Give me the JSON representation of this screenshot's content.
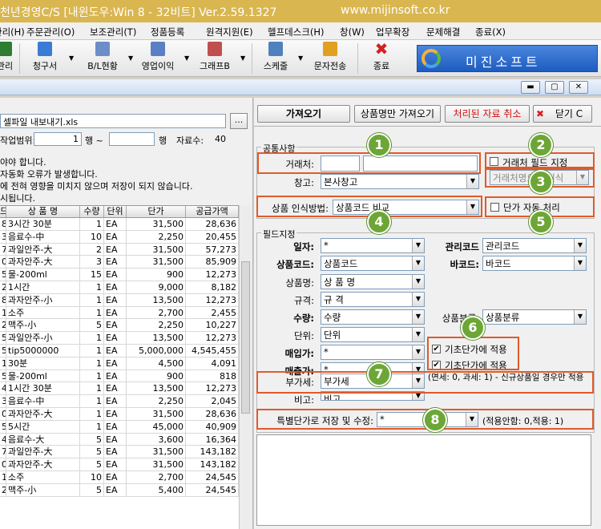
{
  "window": {
    "title": "천년경영C/S [내윈도우:Win 8 - 32비트] Ver.2.59.1327",
    "url": "www.mijinsoft.co.kr"
  },
  "menu": [
    "관리(H)",
    "주문관리(O)",
    "보조관리(T)",
    "정품등록",
    "원격지원(E)",
    "헬프데스크(H)",
    "창(W)",
    "업무확장",
    "문제해결",
    "종료(X)"
  ],
  "toolbar": {
    "items": [
      {
        "label": "관리",
        "icon": "manage-icon",
        "color": "#2e7d32"
      },
      {
        "label": "청구서",
        "icon": "invoice-icon",
        "color": "#3a7bd5"
      },
      {
        "label": "B/L현황",
        "icon": "bl-status-icon",
        "color": "#6b8ec9"
      },
      {
        "label": "영업이익",
        "icon": "sales-profit-icon",
        "color": "#5a7fc4"
      },
      {
        "label": "그래프B",
        "icon": "graph-icon",
        "color": "#c0504d"
      },
      {
        "label": "스케줄",
        "icon": "schedule-icon",
        "color": "#4f81bd"
      },
      {
        "label": "문자전송",
        "icon": "sms-icon",
        "color": "#e0a020"
      },
      {
        "label": "종료",
        "icon": "exit-icon",
        "color": "#d62020"
      }
    ],
    "logo_text": "미진소프트"
  },
  "left": {
    "file_name": "셀파일 내보내기.xls",
    "browse_label": "...",
    "range_label": "작업범위:",
    "range_from": "1",
    "row_label": "행 ~",
    "range_to": "",
    "row_label2": "행",
    "count_label": "자료수:",
    "count_value": "40",
    "notices": [
      "야야 합니다.",
      "자동화 오류가 발생합니다.",
      "에 전혀 영향을 미치지 않으며 저장이 되지 않습니다.",
      "시됩니다."
    ],
    "grid": {
      "headers": [
        "드",
        "상 품 명",
        "수량",
        "단위",
        "단가",
        "공급가액"
      ],
      "rows": [
        [
          "8",
          "3시간 30분",
          "1",
          "EA",
          "31,500",
          "28,636"
        ],
        [
          "3",
          "음료수-中",
          "10",
          "EA",
          "2,250",
          "20,455"
        ],
        [
          "7",
          "과일안주-大",
          "2",
          "EA",
          "31,500",
          "57,273"
        ],
        [
          "0",
          "과자안주-大",
          "3",
          "EA",
          "31,500",
          "85,909"
        ],
        [
          "5",
          "물-200ml",
          "15",
          "EA",
          "900",
          "12,273"
        ],
        [
          "2",
          "1시간",
          "1",
          "EA",
          "9,000",
          "8,182"
        ],
        [
          "8",
          "과자안주-小",
          "1",
          "EA",
          "13,500",
          "12,273"
        ],
        [
          "1",
          "소주",
          "1",
          "EA",
          "2,700",
          "2,455"
        ],
        [
          "2",
          "맥주-小",
          "5",
          "EA",
          "2,250",
          "10,227"
        ],
        [
          "5",
          "과일안주-小",
          "1",
          "EA",
          "13,500",
          "12,273"
        ],
        [
          "5",
          "tip5000000",
          "1",
          "EA",
          "5,000,000",
          "4,545,455"
        ],
        [
          "1",
          "30분",
          "1",
          "EA",
          "4,500",
          "4,091"
        ],
        [
          "5",
          "물-200ml",
          "1",
          "EA",
          "900",
          "818"
        ],
        [
          "4",
          "1시간 30분",
          "1",
          "EA",
          "13,500",
          "12,273"
        ],
        [
          "3",
          "음료수-中",
          "1",
          "EA",
          "2,250",
          "2,045"
        ],
        [
          "0",
          "과자안주-大",
          "1",
          "EA",
          "31,500",
          "28,636"
        ],
        [
          "5",
          "5시간",
          "1",
          "EA",
          "45,000",
          "40,909"
        ],
        [
          "4",
          "음료수-大",
          "5",
          "EA",
          "3,600",
          "16,364"
        ],
        [
          "7",
          "과일안주-大",
          "5",
          "EA",
          "31,500",
          "143,182"
        ],
        [
          "0",
          "과자안주-大",
          "5",
          "EA",
          "31,500",
          "143,182"
        ],
        [
          "1",
          "소주",
          "10",
          "EA",
          "2,700",
          "24,545"
        ],
        [
          "2",
          "맥주-小",
          "5",
          "EA",
          "5,400",
          "24,545"
        ]
      ]
    }
  },
  "right": {
    "buttons": {
      "fetch": "가져오기",
      "fetch_name": "상품명만 가져오기",
      "cancel": "처리된 자료 취소",
      "close": "닫기 C"
    },
    "common": {
      "title": "공통사항",
      "vendor_label": "거래처:",
      "vendor_code": "",
      "vendor_name": "",
      "warehouse_label": "창고:",
      "warehouse_value": "본사창고",
      "vendor_field_check": "거래처 필드 지정",
      "vendor_name_select": "거래처명으로 인식",
      "product_method_label": "상품 인식방법:",
      "product_method_value": "상품코드 비교",
      "auto_price_check": "단가 자동 처리"
    },
    "fields": {
      "title": "필드지정",
      "date": {
        "label": "일자:",
        "value": "*"
      },
      "mgmt_code": {
        "label": "관리코드",
        "value": "관리코드"
      },
      "product_code": {
        "label": "상품코드:",
        "value": "상품코드"
      },
      "barcode": {
        "label": "바코드:",
        "value": "바코드"
      },
      "product_name": {
        "label": "상품명:",
        "value": "상 품 명"
      },
      "spec": {
        "label": "규격:",
        "value": "규 격"
      },
      "qty": {
        "label": "수량:",
        "value": "수량"
      },
      "category": {
        "label": "상품분류:",
        "value": "상품분류"
      },
      "unit": {
        "label": "단위:",
        "value": "단위"
      },
      "buy_price": {
        "label": "매입가:",
        "value": "*"
      },
      "sell_price": {
        "label": "매출가:",
        "value": "*"
      },
      "base_price_check1": "기초단가에 적용",
      "base_price_check2": "기초단가에 적용",
      "vat": {
        "label": "부가세:",
        "value": "부가세"
      },
      "vat_note": "(면세: 0, 과세: 1) - 신규상품일 경우만 적용",
      "note": {
        "label": "비고:",
        "value": "비고"
      },
      "special_label": "특별단가로 저장 및 수정:",
      "special_value": "*",
      "special_note": "(적용안함: 0,적용: 1)"
    }
  },
  "badges": [
    "1",
    "2",
    "3",
    "4",
    "5",
    "6",
    "7",
    "8"
  ],
  "colors": {
    "highlight": "#e05a2a",
    "badge": "#6da636",
    "title_bar": "#d9b64f"
  }
}
